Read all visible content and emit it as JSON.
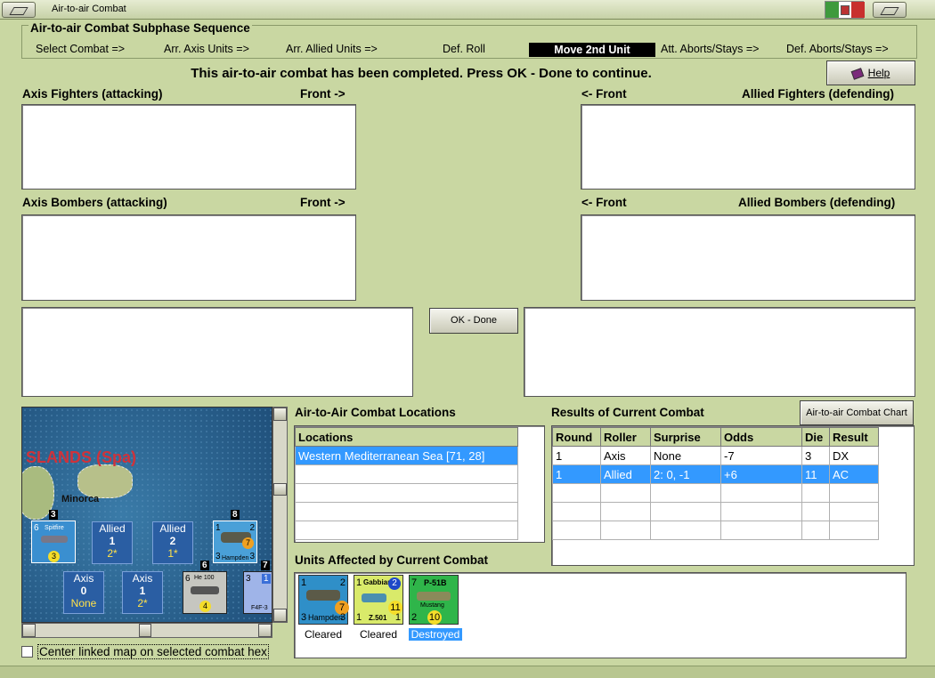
{
  "window": {
    "title": "Air-to-air Combat"
  },
  "sequence": {
    "legend": "Air-to-air Combat Subphase Sequence",
    "steps": [
      "Select Combat =>",
      "Arr. Axis Units =>",
      "Arr. Allied Units =>",
      "Def. Roll",
      "Move 2nd Unit",
      "Att. Aborts/Stays =>",
      "Def. Aborts/Stays =>"
    ],
    "active": "Move 2nd Unit"
  },
  "status": "This air-to-air combat has been completed.  Press OK - Done to continue.",
  "help_label": "Help",
  "panels": {
    "axis_fighters": "Axis Fighters (attacking)",
    "allied_fighters": "Allied Fighters (defending)",
    "axis_bombers": "Axis Bombers (attacking)",
    "allied_bombers": "Allied Bombers (defending)",
    "front_right": "Front ->",
    "front_left": "<- Front"
  },
  "ok_done": "OK - Done",
  "chart_button": "Air-to-air Combat Chart",
  "map": {
    "region_label": "SLANDS (Spa)",
    "island_label": "Minorca",
    "stack_counts": [
      "3",
      "8",
      "6",
      "7"
    ],
    "spitfire": {
      "name": "Spitfire",
      "left": "6",
      "die": "3"
    },
    "hampden": {
      "name": "Hampden",
      "tl": "1",
      "tr": "2",
      "bl": "3",
      "br": "3",
      "die": "7"
    },
    "he100": {
      "name": "He 100",
      "left": "6",
      "die": "4"
    },
    "f4f": {
      "name": "F4F-3",
      "tl": "3",
      "tr": "1"
    },
    "counters": [
      {
        "side": "Allied",
        "num": "1",
        "sub": "2*"
      },
      {
        "side": "Allied",
        "num": "2",
        "sub": "1*"
      },
      {
        "side": "Axis",
        "num": "0",
        "sub": "None"
      },
      {
        "side": "Axis",
        "num": "1",
        "sub": "2*"
      }
    ]
  },
  "center_map_label": "Center linked map on selected combat hex",
  "locations": {
    "title": "Air-to-Air Combat Locations",
    "header": "Locations",
    "rows": [
      "Western Mediterranean Sea [71, 28]"
    ]
  },
  "results": {
    "title": "Results of Current Combat",
    "headers": [
      "Round",
      "Roller",
      "Surprise",
      "Odds",
      "Die",
      "Result"
    ],
    "rows": [
      [
        "1",
        "Axis",
        "None",
        "-7",
        "3",
        "DX"
      ],
      [
        "1",
        "Allied",
        "2: 0, -1",
        "+6",
        "11",
        "AC"
      ]
    ]
  },
  "affected": {
    "title": "Units Affected by Current Combat",
    "units": [
      {
        "name": "Hampden",
        "tl": "1",
        "tr": "2",
        "bl": "3",
        "br": "3",
        "die": "7",
        "status": "Cleared"
      },
      {
        "name": "Gabbiano",
        "sub": "Z.501",
        "tl": "1",
        "bl": "1",
        "br": "1",
        "badge": "2",
        "die": "11",
        "status": "Cleared"
      },
      {
        "name": "P-51B",
        "sub": "Mustang",
        "tl": "7",
        "bl": "2",
        "die": "10",
        "status": "Destroyed"
      }
    ]
  },
  "colors": {
    "background": "#c9d7a2",
    "selection": "#3399ff",
    "allied_counter": "#2a5ea3",
    "die": "#f5dd2a"
  }
}
